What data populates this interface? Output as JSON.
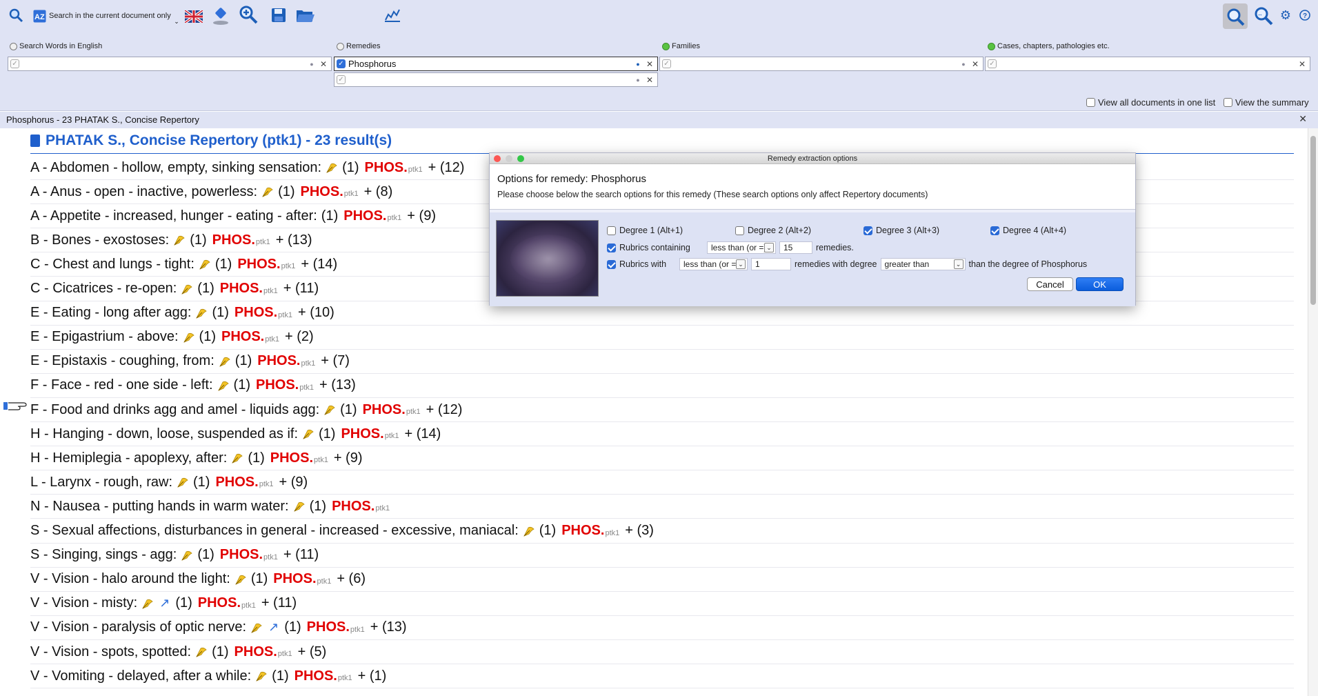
{
  "toolbar": {
    "search_current_label": "Search in the current document only",
    "icons": [
      "magnifier-icon",
      "az-icon",
      "uk-flag-icon",
      "stamp-icon",
      "zoom-plus-icon",
      "save-icon",
      "open-folder-icon",
      "chart-icon",
      "zoom-active-icon",
      "zoom-fit-icon",
      "gear-icon",
      "help-icon"
    ]
  },
  "fields": {
    "words_label": "Search Words in English",
    "remedies_label": "Remedies",
    "families_label": "Families",
    "cases_label": "Cases, chapters, pathologies etc.",
    "remedy_value": "Phosphorus"
  },
  "options": {
    "view_all": "View all documents in one list",
    "view_summary": "View the summary"
  },
  "result_bar": "Phosphorus - 23 PHATAK S., Concise Repertory",
  "document": {
    "title": "PHATAK S., Concise Repertory (ptk1) - 23 result(s)",
    "remedy_abbrev": "PHOS.",
    "source": "ptk1",
    "rows": [
      {
        "rubric": "A - Abdomen - hollow, empty, sinking sensation:",
        "deg": "(1)",
        "plus": "+ (12)",
        "arrow": false
      },
      {
        "rubric": "A - Anus - open - inactive, powerless:",
        "deg": "(1)",
        "plus": "+ (8)",
        "arrow": false
      },
      {
        "rubric": "A - Appetite - increased, hunger - eating - after:",
        "deg": "(1)",
        "plus": "+ (9)",
        "arrow": false,
        "nofeather": true
      },
      {
        "rubric": "B - Bones - exostoses:",
        "deg": "(1)",
        "plus": "+ (13)",
        "arrow": false
      },
      {
        "rubric": "C - Chest and lungs - tight:",
        "deg": "(1)",
        "plus": "+ (14)",
        "arrow": false
      },
      {
        "rubric": "C - Cicatrices - re-open:",
        "deg": "(1)",
        "plus": "+ (11)",
        "arrow": false
      },
      {
        "rubric": "E - Eating - long after agg:",
        "deg": "(1)",
        "plus": "+ (10)",
        "arrow": false
      },
      {
        "rubric": "E - Epigastrium - above:",
        "deg": "(1)",
        "plus": "+ (2)",
        "arrow": false
      },
      {
        "rubric": "E - Epistaxis - coughing, from:",
        "deg": "(1)",
        "plus": "+ (7)",
        "arrow": false
      },
      {
        "rubric": "F - Face - red - one side - left:",
        "deg": "(1)",
        "plus": "+ (13)",
        "arrow": false
      },
      {
        "rubric": "F - Food and drinks agg and amel - liquids agg:",
        "deg": "(1)",
        "plus": "+ (12)",
        "arrow": false
      },
      {
        "rubric": "H - Hanging - down, loose, suspended as if:",
        "deg": "(1)",
        "plus": "+ (14)",
        "arrow": false
      },
      {
        "rubric": "H - Hemiplegia - apoplexy, after:",
        "deg": "(1)",
        "plus": "+ (9)",
        "arrow": false
      },
      {
        "rubric": "L - Larynx - rough, raw:",
        "deg": "(1)",
        "plus": "+ (9)",
        "arrow": false
      },
      {
        "rubric": "N - Nausea - putting hands in warm water:",
        "deg": "(1)",
        "plus": "",
        "arrow": false
      },
      {
        "rubric": "S - Sexual affections, disturbances in general - increased - excessive, maniacal:",
        "deg": "(1)",
        "plus": "+ (3)",
        "arrow": false
      },
      {
        "rubric": "S - Singing, sings - agg:",
        "deg": "(1)",
        "plus": "+ (11)",
        "arrow": false
      },
      {
        "rubric": "V - Vision - halo around the light:",
        "deg": "(1)",
        "plus": "+ (6)",
        "arrow": false
      },
      {
        "rubric": "V - Vision - misty:",
        "deg": "(1)",
        "plus": "+ (11)",
        "arrow": true
      },
      {
        "rubric": "V - Vision - paralysis of optic nerve:",
        "deg": "(1)",
        "plus": "+ (13)",
        "arrow": true
      },
      {
        "rubric": "V - Vision - spots, spotted:",
        "deg": "(1)",
        "plus": "+ (5)",
        "arrow": false
      },
      {
        "rubric": "V - Vomiting - delayed, after a while:",
        "deg": "(1)",
        "plus": "+ (1)",
        "arrow": false
      }
    ]
  },
  "dialog": {
    "title": "Remedy extraction options",
    "heading": "Options for remedy: Phosphorus",
    "subtext": "Please choose below the search options for this remedy (These search options only affect Repertory documents)",
    "degree1": "Degree 1 (Alt+1)",
    "degree2": "Degree 2 (Alt+2)",
    "degree3": "Degree 3 (Alt+3)",
    "degree4": "Degree 4 (Alt+4)",
    "rubrics_containing": "Rubrics containing",
    "sel1": "less than (or =)",
    "count1": "15",
    "remedies_suffix": "remedies.",
    "rubrics_with": "Rubrics with",
    "sel2": "less than (or =)",
    "count2": "1",
    "remedies_with_degree": "remedies with degree",
    "sel3": "greater than",
    "degree_suffix": "than the degree of Phosphorus",
    "cancel": "Cancel",
    "ok": "OK"
  },
  "colors": {
    "accent": "#1f5fcc",
    "remedy": "#e10000",
    "toolbar_bg": "#dfe3f4"
  }
}
